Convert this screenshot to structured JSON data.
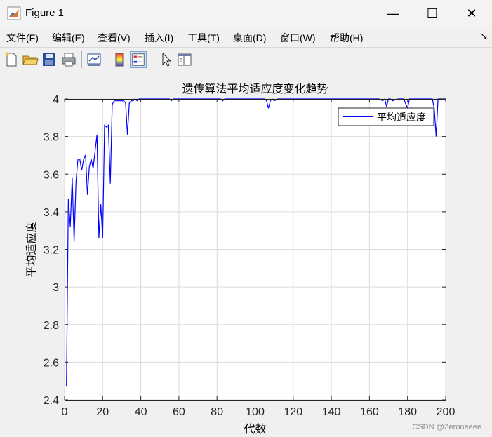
{
  "window": {
    "title": "Figure 1",
    "minimize_glyph": "—",
    "maximize_glyph": "☐",
    "close_glyph": "✕"
  },
  "menu": {
    "items": [
      "文件(F)",
      "编辑(E)",
      "查看(V)",
      "插入(I)",
      "工具(T)",
      "桌面(D)",
      "窗口(W)",
      "帮助(H)"
    ],
    "overflow_glyph": "↘"
  },
  "toolbar": {
    "icons": [
      "new-figure-icon",
      "open-file-icon",
      "save-icon",
      "print-icon",
      "link-plot-icon",
      "colorbar-icon",
      "legend-icon",
      "pointer-icon",
      "property-editor-icon"
    ]
  },
  "watermark": "CSDN @Zeroneeee",
  "chart_data": {
    "type": "line",
    "title": "遗传算法平均适应度变化趋势",
    "xlabel": "代数",
    "ylabel": "平均适应度",
    "xlim": [
      0,
      200
    ],
    "ylim": [
      2.4,
      4
    ],
    "xticks": [
      "0",
      "20",
      "40",
      "60",
      "80",
      "100",
      "120",
      "140",
      "160",
      "180",
      "200"
    ],
    "yticks": [
      "2.4",
      "2.6",
      "2.8",
      "3",
      "3.2",
      "3.4",
      "3.6",
      "3.8",
      "4"
    ],
    "grid": true,
    "legend": {
      "position": "top-right",
      "entries": [
        "平均适应度"
      ]
    },
    "line_color": "#0000ff",
    "series": [
      {
        "name": "平均适应度",
        "x": [
          1,
          2,
          3,
          4,
          5,
          6,
          7,
          8,
          9,
          10,
          11,
          12,
          13,
          14,
          15,
          16,
          17,
          18,
          19,
          20,
          21,
          22,
          23,
          24,
          25,
          26,
          27,
          28,
          29,
          30,
          31,
          32,
          33,
          34,
          35,
          36,
          37,
          38,
          39,
          40,
          41,
          42,
          43,
          44,
          45,
          46,
          47,
          48,
          49,
          50,
          52,
          54,
          55,
          56,
          57,
          58,
          60,
          65,
          70,
          75,
          80,
          82,
          83,
          84,
          86,
          90,
          95,
          100,
          104,
          105,
          106,
          107,
          108,
          109,
          110,
          112,
          115,
          120,
          125,
          130,
          135,
          140,
          145,
          150,
          155,
          160,
          165,
          167,
          168,
          169,
          170,
          171,
          172,
          175,
          178,
          180,
          181,
          182,
          185,
          190,
          192,
          193,
          194,
          195,
          196,
          197,
          200
        ],
        "y": [
          2.47,
          3.47,
          3.32,
          3.58,
          3.24,
          3.56,
          3.68,
          3.68,
          3.62,
          3.68,
          3.7,
          3.49,
          3.64,
          3.68,
          3.63,
          3.72,
          3.81,
          3.26,
          3.44,
          3.26,
          3.86,
          3.85,
          3.86,
          3.55,
          3.97,
          3.99,
          3.99,
          3.99,
          3.99,
          3.99,
          3.99,
          3.98,
          3.81,
          3.98,
          3.99,
          3.99,
          4.0,
          3.99,
          4.0,
          4.0,
          4.0,
          4.0,
          4.0,
          4.0,
          4.0,
          4.0,
          4.0,
          4.0,
          4.0,
          4.0,
          4.0,
          4.0,
          4.0,
          3.99,
          4.0,
          4.0,
          4.0,
          4.0,
          4.0,
          4.0,
          4.0,
          4.0,
          3.99,
          4.0,
          4.0,
          4.0,
          4.0,
          4.0,
          4.0,
          4.0,
          3.99,
          3.95,
          3.99,
          4.0,
          3.99,
          4.0,
          4.0,
          4.0,
          4.0,
          4.0,
          4.0,
          4.0,
          4.0,
          4.0,
          4.0,
          4.0,
          4.0,
          3.99,
          4.0,
          3.96,
          4.0,
          4.0,
          3.99,
          4.0,
          4.0,
          3.95,
          4.0,
          4.0,
          4.0,
          4.0,
          4.0,
          4.0,
          3.95,
          3.8,
          4.0,
          4.0,
          4.0
        ]
      }
    ]
  }
}
